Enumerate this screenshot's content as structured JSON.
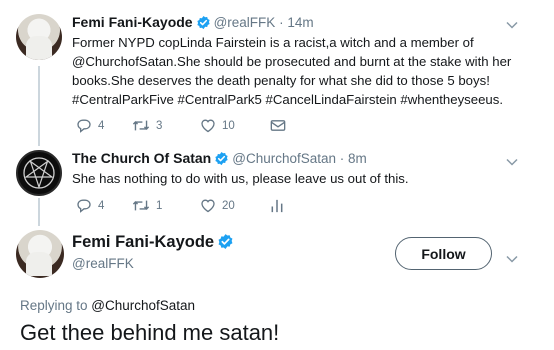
{
  "tweet1": {
    "author_name": "Femi Fani-Kayode",
    "handle": "@realFFK",
    "separator": " · ",
    "time": "14m",
    "lines": [
      "Former NYPD copLinda Fairstein is a racist,a witch and a member of",
      "@ChurchofSatan.She should be prosecuted and burnt at the stake with her",
      "books.She deserves the death penalty for what she did to those 5 boys!",
      "#CentralParkFive #CentralPark5 #CancelLindaFairstein #whentheyseeus."
    ],
    "replies": "4",
    "retweets": "3",
    "likes": "10"
  },
  "tweet2": {
    "author_name": "The Church Of Satan",
    "handle": "@ChurchofSatan",
    "separator": " · ",
    "time": "8m",
    "text": "She has nothing to do with us, please leave us out of this.",
    "replies": "4",
    "retweets": "1",
    "likes": "20"
  },
  "main_tweet": {
    "author_name": "Femi Fani-Kayode",
    "handle": "@realFFK",
    "follow_label": "Follow",
    "replying_prefix": "Replying to ",
    "replying_to": "@ChurchofSatan",
    "text": "Get thee behind me satan!"
  },
  "colors": {
    "verified": "#1da1f2",
    "secondary_text": "#657786",
    "thread_line": "#ccd6dd"
  }
}
